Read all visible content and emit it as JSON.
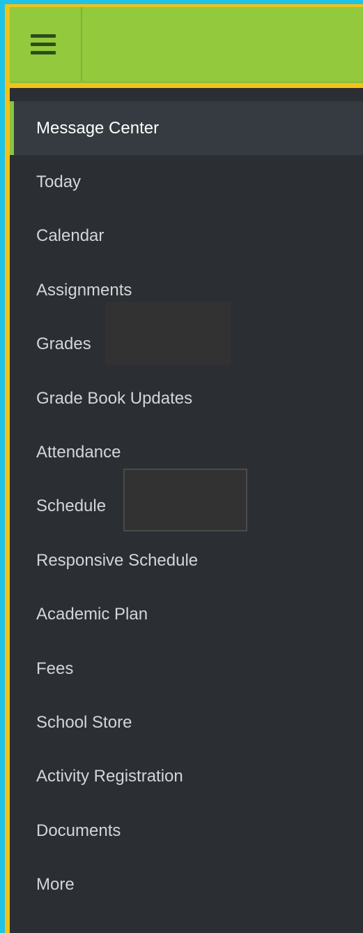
{
  "colors": {
    "outer_border": "#1fc3e6",
    "inner_border": "#f2c21a",
    "topbar": "#93c93d",
    "nav_background": "#2b2f33",
    "active_item": "#353b40",
    "active_indicator": "#8ac43f",
    "hamburger": "#2d4d1a"
  },
  "topbar": {
    "menu_icon": "hamburger-icon"
  },
  "nav": {
    "active_index": 0,
    "items": [
      {
        "label": "Message Center"
      },
      {
        "label": "Today"
      },
      {
        "label": "Calendar"
      },
      {
        "label": "Assignments"
      },
      {
        "label": "Grades"
      },
      {
        "label": "Grade Book Updates"
      },
      {
        "label": "Attendance"
      },
      {
        "label": "Schedule"
      },
      {
        "label": "Responsive Schedule"
      },
      {
        "label": "Academic Plan"
      },
      {
        "label": "Fees"
      },
      {
        "label": "School Store"
      },
      {
        "label": "Activity Registration"
      },
      {
        "label": "Documents"
      },
      {
        "label": "More"
      }
    ]
  }
}
